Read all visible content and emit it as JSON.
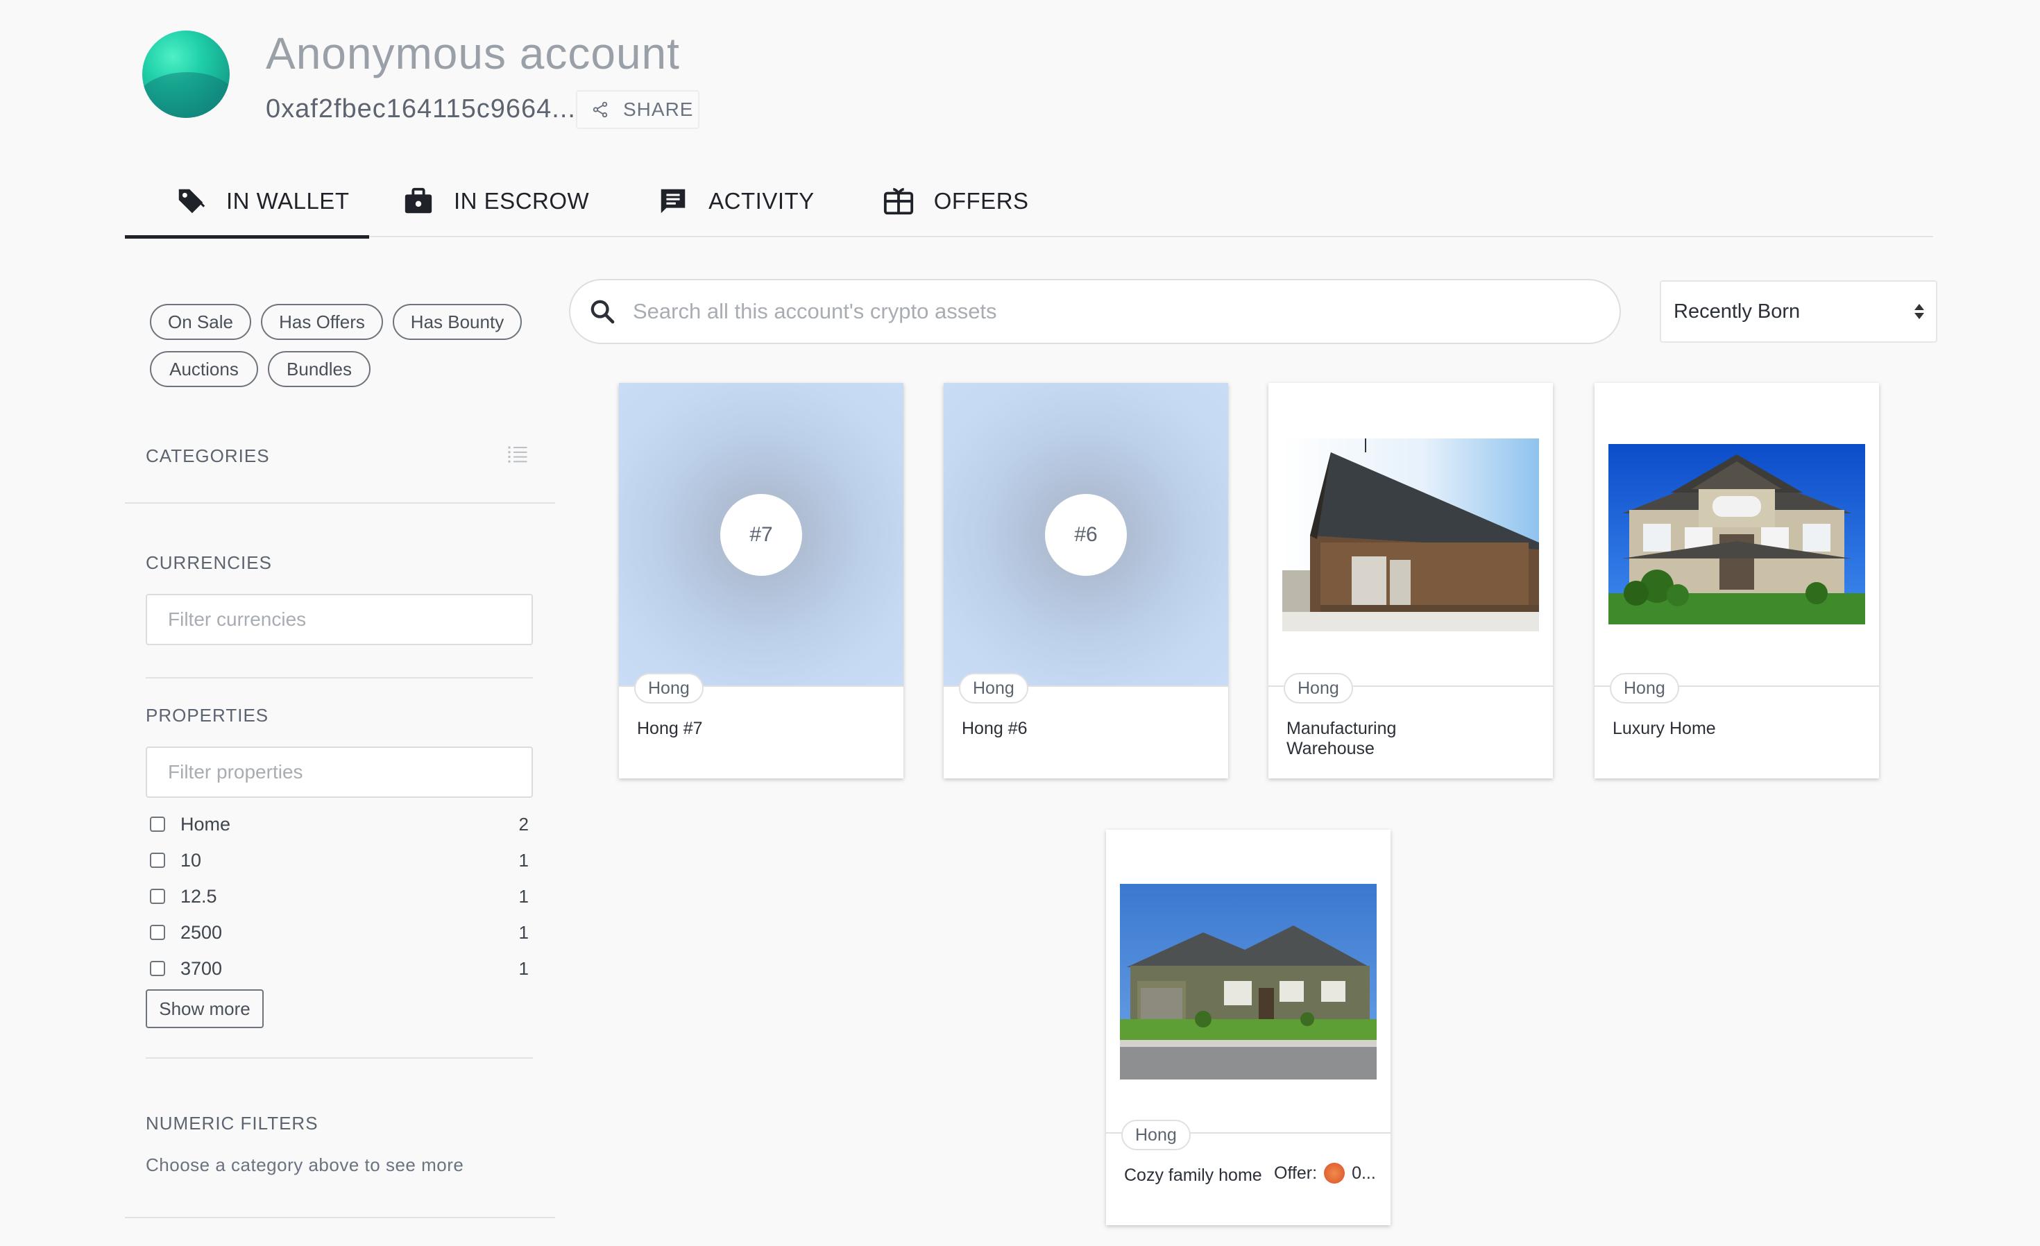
{
  "account": {
    "name": "Anonymous account",
    "address": "0xaf2fbec164115c9664...",
    "share_label": "SHARE"
  },
  "tabs": [
    {
      "label": "IN WALLET",
      "icon": "tag-icon",
      "active": true
    },
    {
      "label": "IN ESCROW",
      "icon": "briefcase-icon",
      "active": false
    },
    {
      "label": "ACTIVITY",
      "icon": "chat-list-icon",
      "active": false
    },
    {
      "label": "OFFERS",
      "icon": "gift-card-icon",
      "active": false
    }
  ],
  "filters": {
    "chips": [
      "On Sale",
      "Has Offers",
      "Has Bounty",
      "Auctions",
      "Bundles"
    ],
    "categories_title": "CATEGORIES",
    "currencies_title": "CURRENCIES",
    "currencies_placeholder": "Filter currencies",
    "properties_title": "PROPERTIES",
    "properties_placeholder": "Filter properties",
    "properties": [
      {
        "label": "Home",
        "count": "2"
      },
      {
        "label": "10",
        "count": "1"
      },
      {
        "label": "12.5",
        "count": "1"
      },
      {
        "label": "2500",
        "count": "1"
      },
      {
        "label": "3700",
        "count": "1"
      }
    ],
    "show_more_label": "Show more",
    "numeric_title": "NUMERIC FILTERS",
    "numeric_hint": "Choose a category above to see more"
  },
  "search": {
    "placeholder": "Search all this account's crypto assets"
  },
  "sort": {
    "selected": "Recently Born"
  },
  "assets": [
    {
      "owner": "Hong",
      "name": "Hong #7",
      "badge": "#7",
      "image": "blurred-placeholder"
    },
    {
      "owner": "Hong",
      "name": "Hong #6",
      "badge": "#6",
      "image": "blurred-placeholder"
    },
    {
      "owner": "Hong",
      "name": "Manufacturing\nWarehouse",
      "image": "warehouse-photo"
    },
    {
      "owner": "Hong",
      "name": "Luxury Home",
      "image": "luxury-home-photo"
    },
    {
      "owner": "Hong",
      "name": "Cozy family home",
      "image": "family-home-photo",
      "offer_label": "Offer:",
      "offer_value": "0..."
    }
  ],
  "colors": {
    "background": "#f9f9f9",
    "text_dark": "#1f2329",
    "text_muted": "#9aa0a7",
    "divider": "#e2e2e2",
    "avatar_teal": "#1fcfa9"
  }
}
